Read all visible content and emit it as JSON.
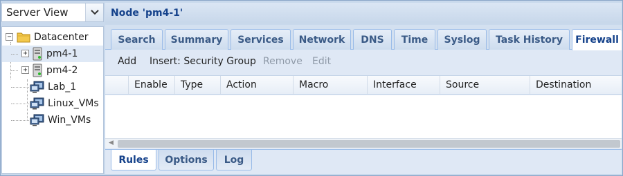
{
  "view_selector": {
    "value": "Server View"
  },
  "tree": {
    "root": {
      "label": "Datacenter"
    },
    "nodes": [
      {
        "label": "pm4-1"
      },
      {
        "label": "pm4-2"
      }
    ],
    "pools": [
      {
        "label": "Lab_1"
      },
      {
        "label": "Linux_VMs"
      },
      {
        "label": "Win_VMs"
      }
    ]
  },
  "header": {
    "title": "Node 'pm4-1'"
  },
  "tabs": [
    "Search",
    "Summary",
    "Services",
    "Network",
    "DNS",
    "Time",
    "Syslog",
    "Task History",
    "Firewall"
  ],
  "active_tab": "Firewall",
  "toolbar": {
    "add": "Add",
    "insert": "Insert: Security Group",
    "remove": "Remove",
    "edit": "Edit"
  },
  "grid": {
    "columns": [
      "Enable",
      "Type",
      "Action",
      "Macro",
      "Interface",
      "Source",
      "Destination"
    ],
    "rows": []
  },
  "bottom_tabs": [
    "Rules",
    "Options",
    "Log"
  ],
  "active_bottom_tab": "Rules",
  "colors": {
    "accent": "#15428b",
    "panel_bg": "#dfe8f5",
    "border": "#99bbe8",
    "disabled_text": "#8f9aa8"
  }
}
